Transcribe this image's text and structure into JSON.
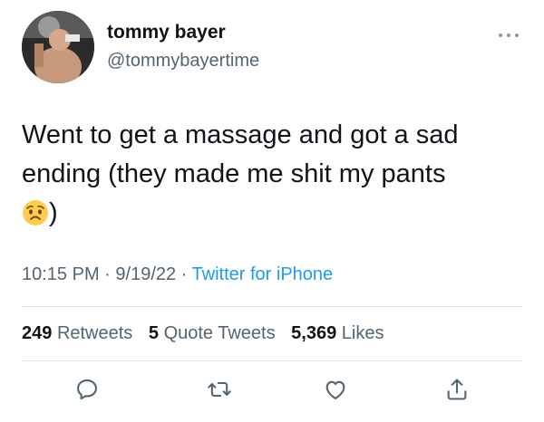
{
  "author": {
    "display_name": "tommy bayer",
    "handle": "@tommybayertime",
    "avatar_icon": "profile-photo"
  },
  "tweet": {
    "text": "Went to get a massage and got a sad ending (they made me shit my pants",
    "emoji": "worried-face-emoji",
    "text_end": ")"
  },
  "meta": {
    "time": "10:15 PM",
    "separator1": " · ",
    "date": "9/19/22",
    "separator2": " · ",
    "source": "Twitter for iPhone"
  },
  "stats": {
    "retweets_count": "249",
    "retweets_label": "Retweets",
    "quotes_count": "5",
    "quotes_label": "Quote Tweets",
    "likes_count": "5,369",
    "likes_label": "Likes"
  },
  "actions": {
    "reply_icon": "reply-icon",
    "retweet_icon": "retweet-icon",
    "like_icon": "like-icon",
    "share_icon": "share-icon"
  },
  "colors": {
    "text": "#0f1419",
    "secondary": "#536471",
    "link": "#1d9bf0",
    "divider": "#dfe3e6"
  }
}
